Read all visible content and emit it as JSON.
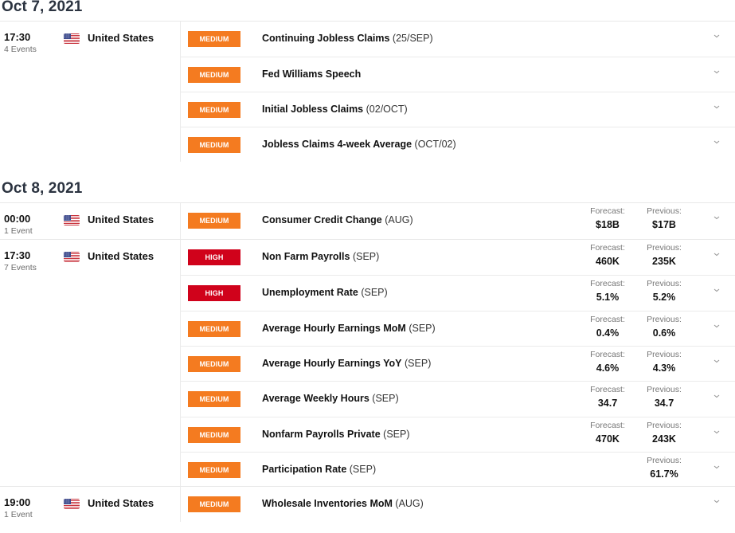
{
  "colors": {
    "medium": "#f47b20",
    "high": "#d0021b",
    "date_heading": "#2b3340"
  },
  "labels": {
    "forecast": "Forecast:",
    "previous": "Previous:"
  },
  "days": [
    {
      "date": "Oct 7, 2021",
      "groups": [
        {
          "time": "17:30",
          "event_count": "4 Events",
          "country": "United States",
          "flag_icon": "us-flag-icon",
          "events": [
            {
              "importance": "MEDIUM",
              "level": "medium",
              "name": "Continuing Jobless Claims",
              "period": "(25/SEP)"
            },
            {
              "importance": "MEDIUM",
              "level": "medium",
              "name": "Fed Williams Speech",
              "period": ""
            },
            {
              "importance": "MEDIUM",
              "level": "medium",
              "name": "Initial Jobless Claims",
              "period": "(02/OCT)"
            },
            {
              "importance": "MEDIUM",
              "level": "medium",
              "name": "Jobless Claims 4-week Average",
              "period": "(OCT/02)"
            }
          ]
        }
      ]
    },
    {
      "date": "Oct 8, 2021",
      "groups": [
        {
          "time": "00:00",
          "event_count": "1 Event",
          "country": "United States",
          "flag_icon": "us-flag-icon",
          "events": [
            {
              "importance": "MEDIUM",
              "level": "medium",
              "name": "Consumer Credit Change",
              "period": "(AUG)",
              "forecast": "$18B",
              "previous": "$17B"
            }
          ]
        },
        {
          "time": "17:30",
          "event_count": "7 Events",
          "country": "United States",
          "flag_icon": "us-flag-icon",
          "events": [
            {
              "importance": "HIGH",
              "level": "high",
              "name": "Non Farm Payrolls",
              "period": "(SEP)",
              "forecast": "460K",
              "previous": "235K"
            },
            {
              "importance": "HIGH",
              "level": "high",
              "name": "Unemployment Rate",
              "period": "(SEP)",
              "forecast": "5.1%",
              "previous": "5.2%"
            },
            {
              "importance": "MEDIUM",
              "level": "medium",
              "name": "Average Hourly Earnings MoM",
              "period": "(SEP)",
              "forecast": "0.4%",
              "previous": "0.6%"
            },
            {
              "importance": "MEDIUM",
              "level": "medium",
              "name": "Average Hourly Earnings YoY",
              "period": "(SEP)",
              "forecast": "4.6%",
              "previous": "4.3%"
            },
            {
              "importance": "MEDIUM",
              "level": "medium",
              "name": "Average Weekly Hours",
              "period": "(SEP)",
              "forecast": "34.7",
              "previous": "34.7"
            },
            {
              "importance": "MEDIUM",
              "level": "medium",
              "name": "Nonfarm Payrolls Private",
              "period": "(SEP)",
              "forecast": "470K",
              "previous": "243K"
            },
            {
              "importance": "MEDIUM",
              "level": "medium",
              "name": "Participation Rate",
              "period": "(SEP)",
              "previous": "61.7%"
            }
          ]
        },
        {
          "time": "19:00",
          "event_count": "1 Event",
          "country": "United States",
          "flag_icon": "us-flag-icon",
          "events": [
            {
              "importance": "MEDIUM",
              "level": "medium",
              "name": "Wholesale Inventories MoM",
              "period": "(AUG)"
            }
          ]
        }
      ]
    }
  ]
}
